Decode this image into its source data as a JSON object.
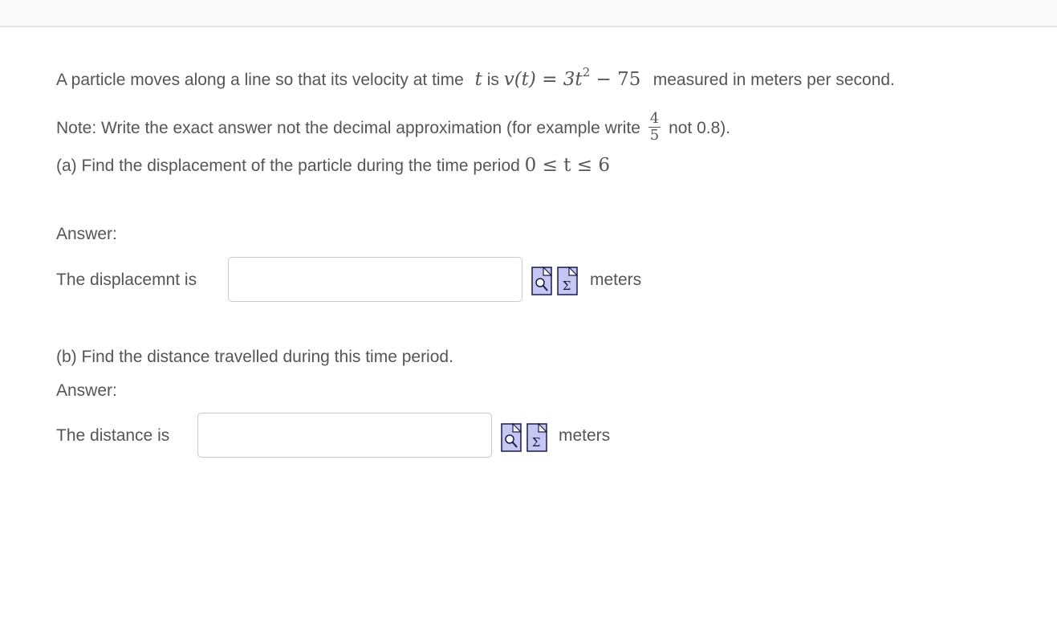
{
  "problem": {
    "intro_a": "A particle moves along a line so that its velocity at time",
    "t_var": "t",
    "intro_b": "is",
    "equation_lhs": "v(t)",
    "equation_eq": "=",
    "equation_coef": "3t",
    "equation_exp": "2",
    "equation_minus": "−",
    "equation_const": "75",
    "intro_c": "measured in meters per second.",
    "note_a": "Note: Write the exact answer not the decimal approximation (for example write",
    "note_frac_num": "4",
    "note_frac_den": "5",
    "note_b": "not 0.8).",
    "part_a_text": "(a) Find the displacement of the particle during the time period",
    "part_a_interval": "0 ≤ t ≤ 6",
    "part_b_text": "(b) Find the distance travelled during this time period."
  },
  "answer_a": {
    "answer_label": "Answer:",
    "prompt": "The displacemnt is",
    "value": "",
    "placeholder": "",
    "unit": "meters"
  },
  "answer_b": {
    "answer_label": "Answer:",
    "prompt": "The distance is",
    "value": "",
    "placeholder": "",
    "unit": "meters"
  },
  "icons": {
    "preview": "preview-answer-icon",
    "equation": "equation-editor-icon"
  },
  "colors": {
    "text": "#555555",
    "icon_fill": "#c6c6f2",
    "icon_border": "#1a1a4a",
    "input_border": "#c9c9c9"
  }
}
